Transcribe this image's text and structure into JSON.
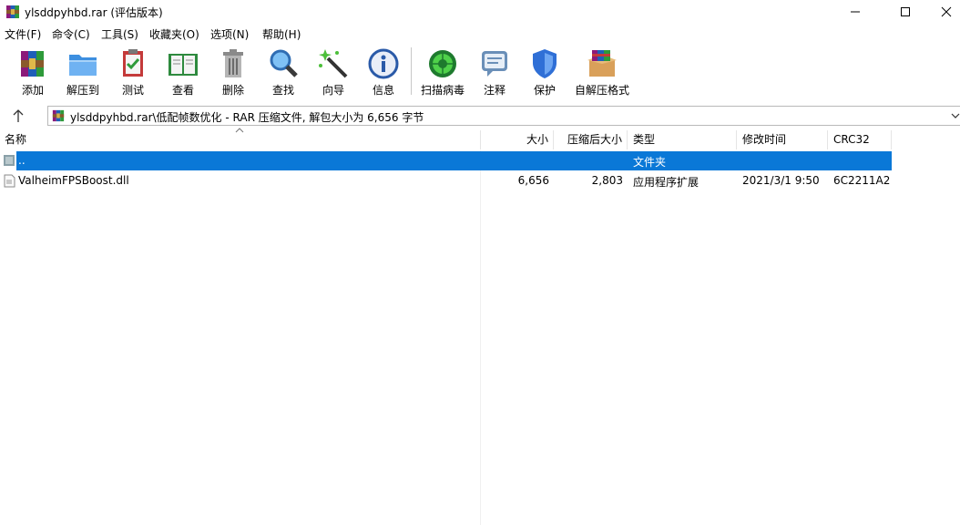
{
  "window": {
    "title": "ylsddpyhbd.rar (评估版本)",
    "accent": "#0a78d7"
  },
  "menu": [
    "文件(F)",
    "命令(C)",
    "工具(S)",
    "收藏夹(O)",
    "选项(N)",
    "帮助(H)"
  ],
  "toolbar": [
    {
      "label": "添加",
      "icon": "add-archive-icon"
    },
    {
      "label": "解压到",
      "icon": "extract-folder-icon"
    },
    {
      "label": "测试",
      "icon": "test-clipboard-icon"
    },
    {
      "label": "查看",
      "icon": "view-book-icon"
    },
    {
      "label": "删除",
      "icon": "trash-icon"
    },
    {
      "label": "查找",
      "icon": "magnifier-icon"
    },
    {
      "label": "向导",
      "icon": "magic-wand-icon"
    },
    {
      "label": "信息",
      "icon": "info-icon"
    },
    {
      "label": "扫描病毒",
      "icon": "virus-scan-icon"
    },
    {
      "label": "注释",
      "icon": "comment-icon"
    },
    {
      "label": "保护",
      "icon": "shield-icon"
    },
    {
      "label": "自解压格式",
      "icon": "sfx-box-icon"
    }
  ],
  "address": {
    "text": "ylsddpyhbd.rar\\低配帧数优化 - RAR 压缩文件, 解包大小为 6,656 字节"
  },
  "columns": {
    "name": "名称",
    "size": "大小",
    "packed": "压缩后大小",
    "type": "类型",
    "modified": "修改时间",
    "crc": "CRC32"
  },
  "rows": [
    {
      "name": "..",
      "size": "",
      "packed": "",
      "type": "文件夹",
      "modified": "",
      "crc": "",
      "selected": true
    },
    {
      "name": "ValheimFPSBoost.dll",
      "size": "6,656",
      "packed": "2,803",
      "type": "应用程序扩展",
      "modified": "2021/3/1 9:50",
      "crc": "6C2211A2",
      "selected": false
    }
  ]
}
